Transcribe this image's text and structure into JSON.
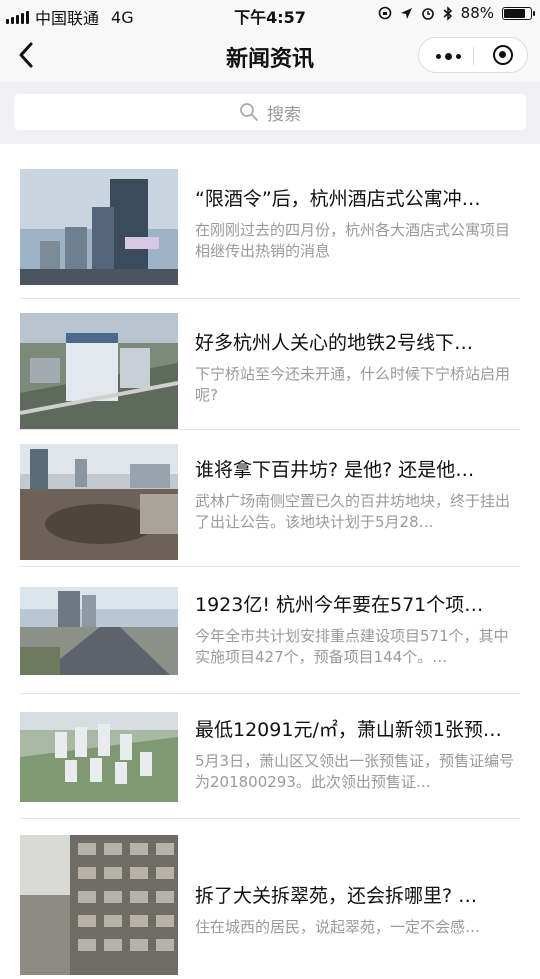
{
  "status_bar": {
    "carrier": "中国联通",
    "network": "4G",
    "time": "下午4:57",
    "battery": "88%",
    "battery_level": 0.88
  },
  "nav": {
    "title": "新闻资讯",
    "back_icon": "chevron-left-icon",
    "more_icon": "more-dots-icon",
    "close_icon": "target-circle-icon"
  },
  "search": {
    "placeholder": "搜索",
    "icon": "search-icon"
  },
  "articles": [
    {
      "title": "“限酒令”后，杭州酒店式公寓冲…",
      "desc": "在刚刚过去的四月份，杭州各大酒店式公寓项目相继传出热销的消息"
    },
    {
      "title": "好多杭州人关心的地铁2号线下…",
      "desc": "下宁桥站至今还未开通，什么时候下宁桥站启用呢?"
    },
    {
      "title": "谁将拿下百井坊? 是他? 还是他…",
      "desc": "武林广场南侧空置已久的百井坊地块，终于挂出了出让公告。该地块计划于5月28…"
    },
    {
      "title": "1923亿! 杭州今年要在571个项…",
      "desc": "今年全市共计划安排重点建设项目571个，其中实施项目427个，预备项目144个。…"
    },
    {
      "title": "最低12091元/㎡，萧山新领1张预…",
      "desc": "5月3日，萧山区又领出一张预售证，预售证编号为201800293。此次领出预售证…"
    },
    {
      "title": "拆了大关拆翠苑，还会拆哪里? …",
      "desc": "住在城西的居民，说起翠苑，一定不会感…"
    }
  ]
}
